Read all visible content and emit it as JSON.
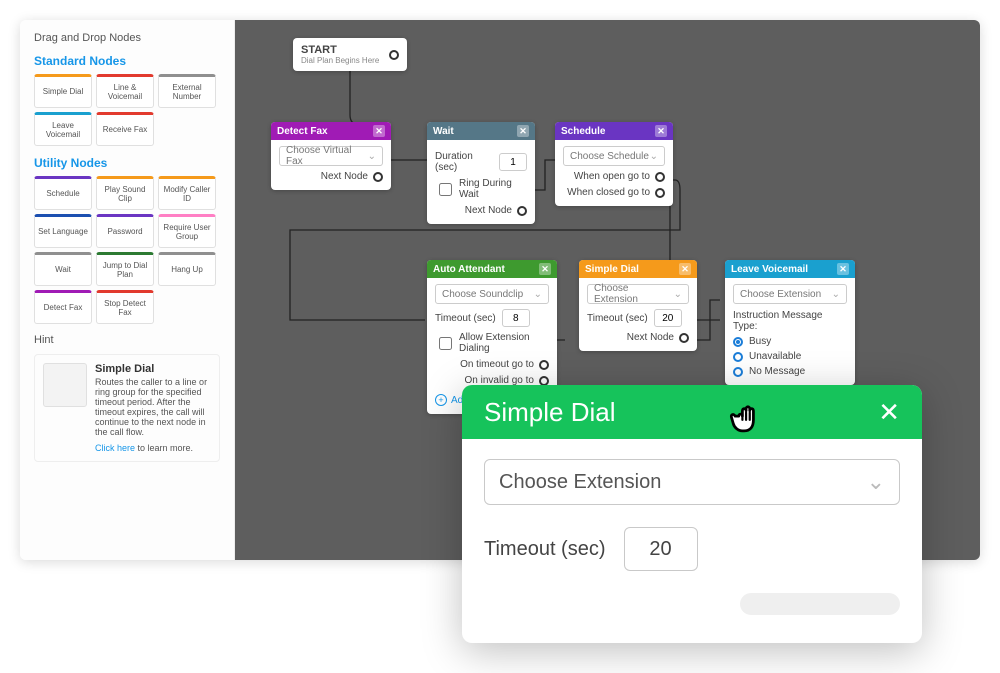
{
  "sidebar": {
    "title": "Drag and Drop Nodes",
    "standard_h": "Standard Nodes",
    "utility_h": "Utility Nodes",
    "standard": [
      {
        "label": "Simple Dial",
        "color": "#f59a1b"
      },
      {
        "label": "Line & Voicemail",
        "color": "#e23a2e"
      },
      {
        "label": "External Number",
        "color": "#8f8f8f"
      },
      {
        "label": "Leave Voicemail",
        "color": "#1aa0cf"
      },
      {
        "label": "Receive Fax",
        "color": "#e23a2e"
      }
    ],
    "utility": [
      {
        "label": "Schedule",
        "color": "#6a35c2"
      },
      {
        "label": "Play Sound Clip",
        "color": "#f59a1b"
      },
      {
        "label": "Modify Caller ID",
        "color": "#f59a1b"
      },
      {
        "label": "Set Language",
        "color": "#1b4fb0"
      },
      {
        "label": "Password",
        "color": "#6a35c2"
      },
      {
        "label": "Require User Group",
        "color": "#ff7fc4"
      },
      {
        "label": "Wait",
        "color": "#8f8f8f"
      },
      {
        "label": "Jump to Dial Plan",
        "color": "#2c7a32"
      },
      {
        "label": "Hang Up",
        "color": "#8f8f8f"
      },
      {
        "label": "Detect Fax",
        "color": "#a01bb5"
      },
      {
        "label": "Stop Detect Fax",
        "color": "#e23a2e"
      }
    ],
    "hint": {
      "section": "Hint",
      "title": "Simple Dial",
      "body": "Routes the caller to a line or ring group for the specified timeout period. After the timeout expires, the call will continue to the next node in the call flow.",
      "link": "Click here",
      "link_tail": " to learn more."
    }
  },
  "canvas": {
    "start": {
      "title": "START",
      "sub": "Dial Plan Begins Here"
    },
    "detect_fax": {
      "title": "Detect Fax",
      "select": "Choose Virtual Fax",
      "next": "Next Node"
    },
    "wait": {
      "title": "Wait",
      "duration_l": "Duration (sec)",
      "duration_v": "1",
      "ring": "Ring During Wait",
      "next": "Next Node"
    },
    "schedule": {
      "title": "Schedule",
      "select": "Choose Schedule",
      "open": "When open go to",
      "closed": "When closed go to"
    },
    "auto": {
      "title": "Auto Attendant",
      "select": "Choose Soundclip",
      "timeout_l": "Timeout (sec)",
      "timeout_v": "8",
      "allow": "Allow Extension Dialing",
      "on_timeout": "On timeout go to",
      "on_invalid": "On invalid go to",
      "add": "Add option"
    },
    "simple": {
      "title": "Simple Dial",
      "select": "Choose Extension",
      "timeout_l": "Timeout (sec)",
      "timeout_v": "20",
      "next": "Next Node"
    },
    "leave": {
      "title": "Leave Voicemail",
      "select": "Choose Extension",
      "msg_type": "Instruction Message Type:",
      "r1": "Busy",
      "r2": "Unavailable",
      "r3": "No Message"
    }
  },
  "modal": {
    "title": "Simple Dial",
    "select": "Choose Extension",
    "timeout_l": "Timeout (sec)",
    "timeout_v": "20"
  }
}
